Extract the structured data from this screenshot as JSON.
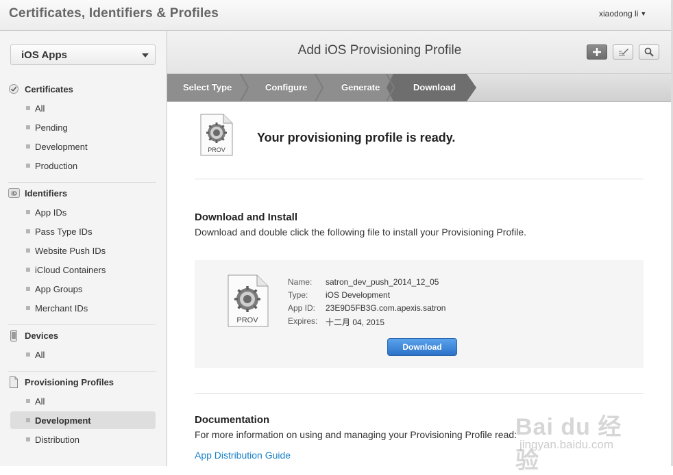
{
  "topbar": {
    "title": "Certificates, Identifiers & Profiles",
    "user": "xiaodong li",
    "user_caret": "▼"
  },
  "sidebar": {
    "platform": "iOS Apps",
    "sections": [
      {
        "title": "Certificates",
        "icon": "certificate-check-icon",
        "items": [
          "All",
          "Pending",
          "Development",
          "Production"
        ]
      },
      {
        "title": "Identifiers",
        "icon": "id-badge-icon",
        "items": [
          "App IDs",
          "Pass Type IDs",
          "Website Push IDs",
          "iCloud Containers",
          "App Groups",
          "Merchant IDs"
        ]
      },
      {
        "title": "Devices",
        "icon": "iphone-icon",
        "items": [
          "All"
        ]
      },
      {
        "title": "Provisioning Profiles",
        "icon": "document-icon",
        "items": [
          "All",
          "Development",
          "Distribution"
        ],
        "active": "Development"
      }
    ],
    "id_icon_text": "ID"
  },
  "header": {
    "title": "Add iOS Provisioning Profile",
    "buttons": [
      "add-icon",
      "edit-icon",
      "search-icon"
    ]
  },
  "steps": [
    "Select Type",
    "Configure",
    "Generate",
    "Download"
  ],
  "ready": {
    "icon_label": "PROV",
    "message": "Your provisioning profile is ready."
  },
  "download_section": {
    "heading": "Download and Install",
    "description": "Download and double click the following file to install your Provisioning Profile."
  },
  "profile": {
    "icon_label": "PROV",
    "name_label": "Name:",
    "name": "satron_dev_push_2014_12_05",
    "type_label": "Type:",
    "type": "iOS Development",
    "appid_label": "App ID:",
    "app_id": "23E9D5FB3G.com.apexis.satron",
    "expires_label": "Expires:",
    "expires": "十二月 04, 2015",
    "button": "Download"
  },
  "documentation": {
    "heading": "Documentation",
    "description": "For more information on using and managing your Provisioning Profile read:",
    "link": "App Distribution Guide"
  },
  "watermark": {
    "brand": "Bai du 经验",
    "site": "jingyan.baidu.com"
  },
  "colors": {
    "accent": "#2c72c9",
    "link": "#1a80c8",
    "step_bar": "#8e8e8e",
    "step_active": "#6e6e6e"
  }
}
